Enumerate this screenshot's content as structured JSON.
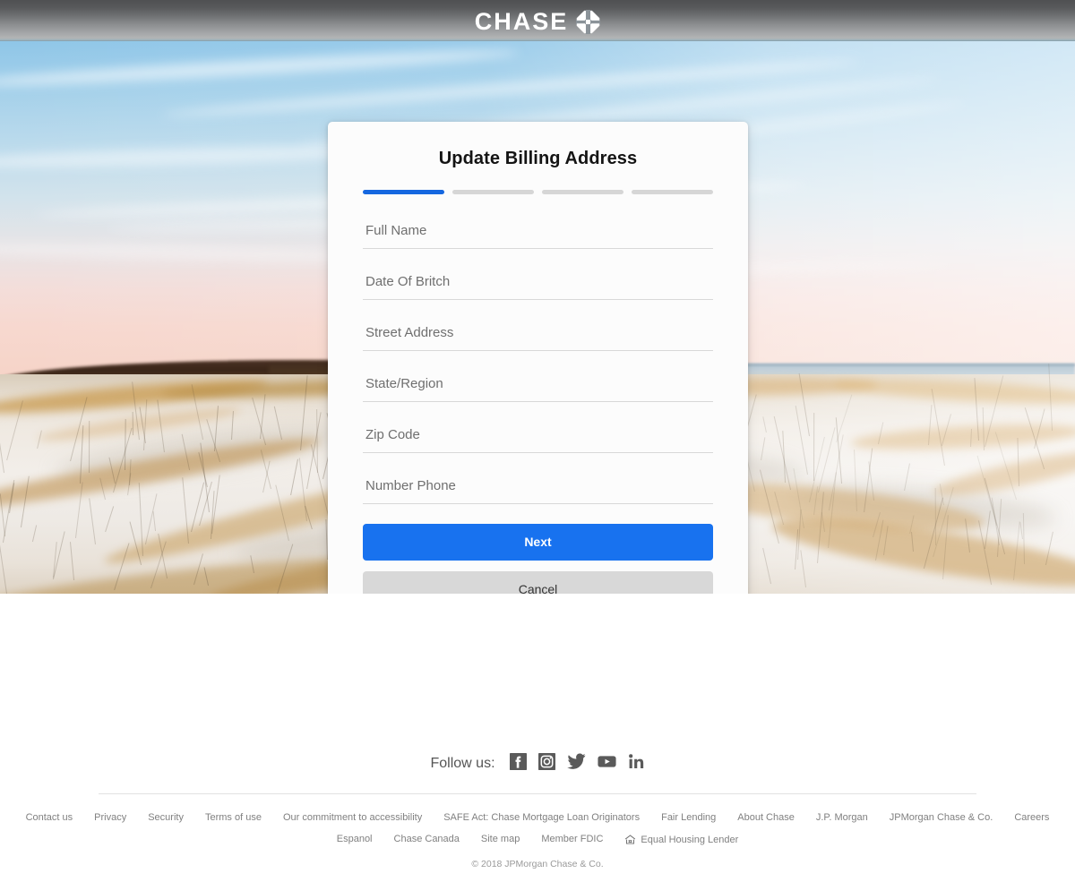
{
  "header": {
    "brand_wordmark": "CHASE",
    "logo_icon": "chase-octagon-logo"
  },
  "hero": {
    "image_description": "beach dunes at sunset with sea oats and pastel sky"
  },
  "card": {
    "title": "Update Billing Address",
    "progress": {
      "total_steps": 4,
      "current_step": 1,
      "active_color": "#1567e0",
      "inactive_color": "#d6d6d6"
    },
    "fields": [
      {
        "name": "full-name",
        "placeholder": "Full Name",
        "value": ""
      },
      {
        "name": "date-of-birth",
        "placeholder": "Date Of Britch",
        "value": ""
      },
      {
        "name": "street-address",
        "placeholder": "Street Address",
        "value": ""
      },
      {
        "name": "state-region",
        "placeholder": "State/Region",
        "value": ""
      },
      {
        "name": "zip-code",
        "placeholder": "Zip Code",
        "value": ""
      },
      {
        "name": "phone-number",
        "placeholder": "Number Phone",
        "value": ""
      }
    ],
    "next_label": "Next",
    "cancel_label": "Cancel",
    "next_color": "#1872ef",
    "cancel_color": "#d8d8d8"
  },
  "footer": {
    "follow_label": "Follow us:",
    "social": [
      {
        "name": "facebook-icon",
        "label": "Facebook"
      },
      {
        "name": "instagram-icon",
        "label": "Instagram"
      },
      {
        "name": "twitter-icon",
        "label": "Twitter"
      },
      {
        "name": "youtube-icon",
        "label": "YouTube"
      },
      {
        "name": "linkedin-icon",
        "label": "LinkedIn"
      }
    ],
    "links_row_1": [
      "Contact us",
      "Privacy",
      "Security",
      "Terms of use",
      "Our commitment to accessibility",
      "SAFE Act: Chase Mortgage Loan Originators",
      "Fair Lending",
      "About Chase",
      "J.P. Morgan",
      "JPMorgan Chase & Co.",
      "Careers"
    ],
    "links_row_2": [
      "Espanol",
      "Chase Canada",
      "Site map",
      "Member FDIC"
    ],
    "equal_housing_label": "Equal Housing Lender",
    "equal_housing_icon": "equal-housing-lender-icon",
    "copyright": "© 2018 JPMorgan Chase & Co."
  }
}
